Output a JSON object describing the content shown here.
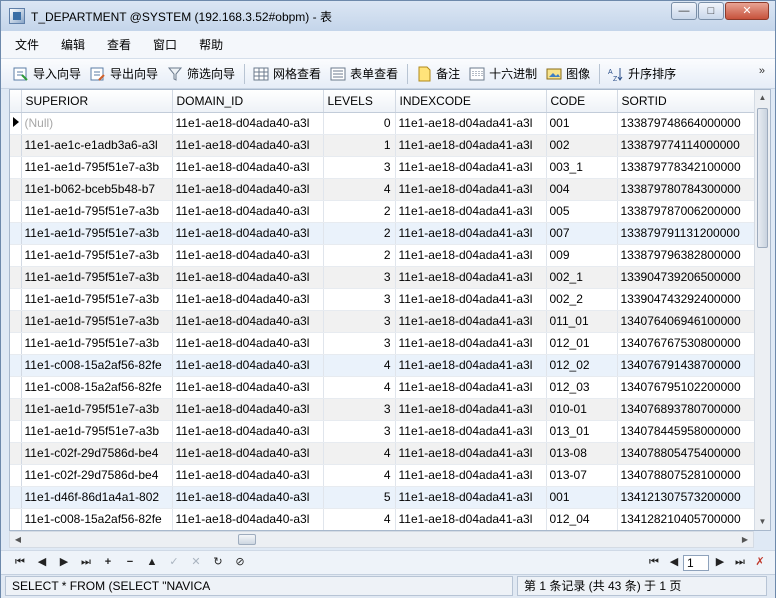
{
  "window": {
    "title": "T_DEPARTMENT @SYSTEM (192.168.3.52#obpm) - 表"
  },
  "menu": {
    "items": [
      "文件",
      "编辑",
      "查看",
      "窗口",
      "帮助"
    ]
  },
  "toolbar": {
    "import_wizard": "导入向导",
    "export_wizard": "导出向导",
    "filter_wizard": "筛选向导",
    "grid_view": "网格查看",
    "form_view": "表单查看",
    "memo": "备注",
    "hex": "十六进制",
    "image": "图像",
    "sort_asc": "升序排序",
    "more": "»"
  },
  "grid": {
    "columns": [
      "SUPERIOR",
      "DOMAIN_ID",
      "LEVELS",
      "INDEXCODE",
      "CODE",
      "SORTID"
    ],
    "rows": [
      [
        "(Null)",
        "11e1-ae18-d04ada40-a3l",
        "0",
        "11e1-ae18-d04ada41-a3l",
        "001",
        "133879748664000000"
      ],
      [
        "11e1-ae1c-e1adb3a6-a3l",
        "11e1-ae18-d04ada40-a3l",
        "1",
        "11e1-ae18-d04ada41-a3l",
        "002",
        "133879774114000000"
      ],
      [
        "11e1-ae1d-795f51e7-a3b",
        "11e1-ae18-d04ada40-a3l",
        "3",
        "11e1-ae18-d04ada41-a3l",
        "003_1",
        "133879778342100000"
      ],
      [
        "11e1-b062-bceb5b48-b7",
        "11e1-ae18-d04ada40-a3l",
        "4",
        "11e1-ae18-d04ada41-a3l",
        "004",
        "133879780784300000"
      ],
      [
        "11e1-ae1d-795f51e7-a3b",
        "11e1-ae18-d04ada40-a3l",
        "2",
        "11e1-ae18-d04ada41-a3l",
        "005",
        "133879787006200000"
      ],
      [
        "11e1-ae1d-795f51e7-a3b",
        "11e1-ae18-d04ada40-a3l",
        "2",
        "11e1-ae18-d04ada41-a3l",
        "007",
        "133879791131200000"
      ],
      [
        "11e1-ae1d-795f51e7-a3b",
        "11e1-ae18-d04ada40-a3l",
        "2",
        "11e1-ae18-d04ada41-a3l",
        "009",
        "133879796382800000"
      ],
      [
        "11e1-ae1d-795f51e7-a3b",
        "11e1-ae18-d04ada40-a3l",
        "3",
        "11e1-ae18-d04ada41-a3l",
        "002_1",
        "133904739206500000"
      ],
      [
        "11e1-ae1d-795f51e7-a3b",
        "11e1-ae18-d04ada40-a3l",
        "3",
        "11e1-ae18-d04ada41-a3l",
        "002_2",
        "133904743292400000"
      ],
      [
        "11e1-ae1d-795f51e7-a3b",
        "11e1-ae18-d04ada40-a3l",
        "3",
        "11e1-ae18-d04ada41-a3l",
        "011_01",
        "134076406946100000"
      ],
      [
        "11e1-ae1d-795f51e7-a3b",
        "11e1-ae18-d04ada40-a3l",
        "3",
        "11e1-ae18-d04ada41-a3l",
        "012_01",
        "134076767530800000"
      ],
      [
        "11e1-c008-15a2af56-82fe",
        "11e1-ae18-d04ada40-a3l",
        "4",
        "11e1-ae18-d04ada41-a3l",
        "012_02",
        "134076791438700000"
      ],
      [
        "11e1-c008-15a2af56-82fe",
        "11e1-ae18-d04ada40-a3l",
        "4",
        "11e1-ae18-d04ada41-a3l",
        "012_03",
        "134076795102200000"
      ],
      [
        "11e1-ae1d-795f51e7-a3b",
        "11e1-ae18-d04ada40-a3l",
        "3",
        "11e1-ae18-d04ada41-a3l",
        "010-01",
        "134076893780700000"
      ],
      [
        "11e1-ae1d-795f51e7-a3b",
        "11e1-ae18-d04ada40-a3l",
        "3",
        "11e1-ae18-d04ada41-a3l",
        "013_01",
        "134078445958000000"
      ],
      [
        "11e1-c02f-29d7586d-be4",
        "11e1-ae18-d04ada40-a3l",
        "4",
        "11e1-ae18-d04ada41-a3l",
        "013-08",
        "134078805475400000"
      ],
      [
        "11e1-c02f-29d7586d-be4",
        "11e1-ae18-d04ada40-a3l",
        "4",
        "11e1-ae18-d04ada41-a3l",
        "013-07",
        "134078807528100000"
      ],
      [
        "11e1-d46f-86d1a4a1-802",
        "11e1-ae18-d04ada40-a3l",
        "5",
        "11e1-ae18-d04ada41-a3l",
        "001",
        "134121307573200000"
      ],
      [
        "11e1-c008-15a2af56-82fe",
        "11e1-ae18-d04ada40-a3l",
        "4",
        "11e1-ae18-d04ada41-a3l",
        "012_04",
        "134128210405700000"
      ]
    ]
  },
  "navigation": {
    "page_value": "1"
  },
  "status": {
    "sql": "SELECT * FROM (SELECT \"NAVICA",
    "record_info": "第 1 条记录 (共 43 条) 于 1 页"
  }
}
